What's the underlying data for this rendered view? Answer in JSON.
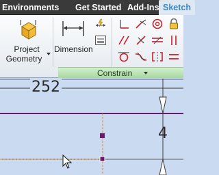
{
  "tabs": [
    {
      "label": "Environments"
    },
    {
      "label": "Get Started"
    },
    {
      "label": "Add-Ins"
    },
    {
      "label": "Sketch"
    }
  ],
  "ribbon": {
    "project_geometry": {
      "line1": "Project",
      "line2": "Geometry"
    },
    "dimension": {
      "label": "Dimension"
    },
    "panel_label": "Constrain"
  },
  "sketch": {
    "dim_horizontal": "252",
    "dim_vertical": "4"
  },
  "colors": {
    "menu_bar": "#3a3a3a",
    "active_tab_text": "#3b88c4",
    "canvas": "#c9daf1",
    "constraint_red": "#c8202c",
    "sketch_line": "#6a1a6e",
    "construction_orange": "#e48a1a"
  }
}
